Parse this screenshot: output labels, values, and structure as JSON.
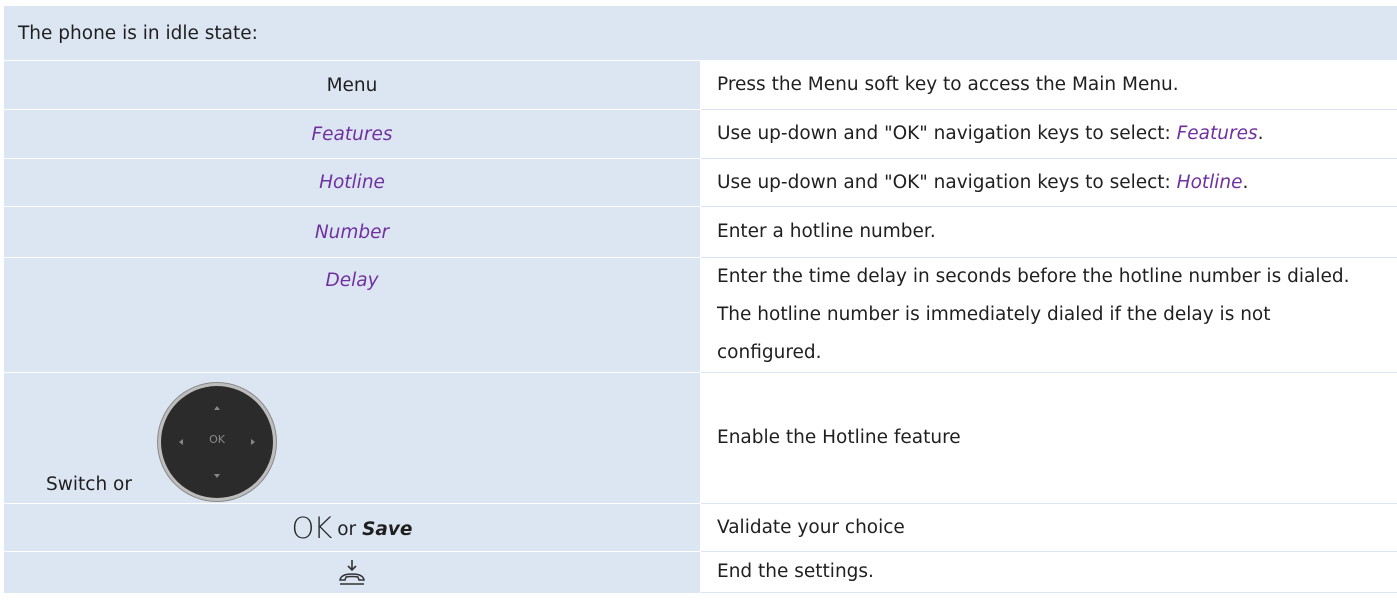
{
  "header": {
    "text": "The phone is in idle state:"
  },
  "steps": [
    {
      "key": "Menu",
      "description": "Press the Menu soft key to access the Main Menu."
    },
    {
      "key": "Features",
      "description_prefix": "Use up-down and \"OK\" navigation keys to select: ",
      "description_item": "Features",
      "description_suffix": "."
    },
    {
      "key": "Hotline",
      "description_prefix": "Use up-down and \"OK\" navigation keys to select: ",
      "description_item": "Hotline",
      "description_suffix": "."
    },
    {
      "key": "Number",
      "description": "Enter a hotline number."
    },
    {
      "key": "Delay",
      "description": "Enter the time delay in seconds before the hotline number is dialed. The hotline number is immediately dialed if the delay is not configured."
    },
    {
      "key_label": "Switch or",
      "key_icon": "navigation-ok-key-icon",
      "key_icon_text": "OK",
      "description": "Enable the Hotline feature"
    },
    {
      "key_ok": "OK",
      "key_or": "or",
      "key_save": "Save",
      "description": "Validate your choice"
    },
    {
      "key_icon": "hang-up-icon",
      "description": "End the settings."
    }
  ],
  "colors": {
    "key_column_bg": "#dce6f2",
    "menu_item_text": "#7030a0",
    "nav_key_body": "#2b2b2b"
  }
}
